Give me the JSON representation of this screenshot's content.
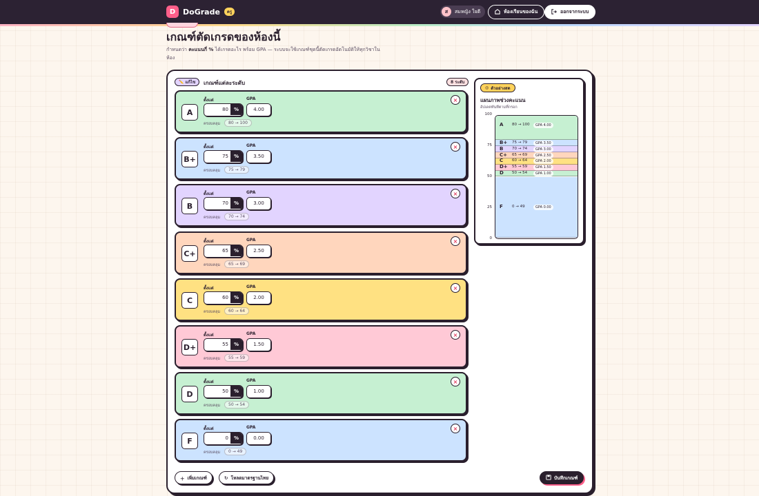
{
  "header": {
    "logo_letter": "D",
    "app_name": "DoGrade",
    "badge": "ครู",
    "user_initial": "ส",
    "user_name": "สมหญิง ใจดี",
    "classroom_btn": "ห้องเรียนของฉัน",
    "logout_btn": "ออกจากระบบ"
  },
  "page": {
    "title": "เกณฑ์ตัดเกรดของห้องนี้",
    "desc_pre": "กำหนดว่า ",
    "desc_bold": "คะแนนกี่ %",
    "desc_post": " ได้เกรดอะไร พร้อม GPA — ระบบจะใช้เกณฑ์ชุดนี้ตัดเกรดอัตโนมัติให้ทุกวิชาในห้อง"
  },
  "editor": {
    "pill": "✏️ แก้ไข",
    "title": "เกณฑ์แต่ละระดับ",
    "level_count": "8 ระดับ",
    "label_from": "ตั้งแต่",
    "label_gpa": "GPA",
    "label_range": "ครอบคลุม",
    "percent_sign": "%",
    "grades": [
      {
        "grade": "A",
        "min": "80",
        "gpa": "4.00",
        "range": "80 → 100",
        "color": "#c6f0d2"
      },
      {
        "grade": "B+",
        "min": "75",
        "gpa": "3.50",
        "range": "75 → 79",
        "color": "#cce3ff"
      },
      {
        "grade": "B",
        "min": "70",
        "gpa": "3.00",
        "range": "70 → 74",
        "color": "#e2d4ff"
      },
      {
        "grade": "C+",
        "min": "65",
        "gpa": "2.50",
        "range": "65 → 69",
        "color": "#ffd6bd"
      },
      {
        "grade": "C",
        "min": "60",
        "gpa": "2.00",
        "range": "60 → 64",
        "color": "#ffe182"
      },
      {
        "grade": "D+",
        "min": "55",
        "gpa": "1.50",
        "range": "55 → 59",
        "color": "#ffc9d6"
      },
      {
        "grade": "D",
        "min": "50",
        "gpa": "1.00",
        "range": "50 → 54",
        "color": "#c6f0d2"
      },
      {
        "grade": "F",
        "min": "0",
        "gpa": "0.00",
        "range": "0 → 49",
        "color": "#cce3ff"
      }
    ]
  },
  "actions": {
    "add": "เพิ่มเกณฑ์",
    "load_standard": "โหลดมาตรฐานไทย",
    "save": "บันทึกเกณฑ์"
  },
  "preview": {
    "pill": "ตัวอย่างสด",
    "title": "แผนภาพช่วงคะแนน",
    "subtitle": "อัปเดตทันทีตามที่กรอก",
    "ticks": [
      "100",
      "75",
      "50",
      "25",
      "0"
    ],
    "bars": [
      {
        "grade": "A",
        "from": 80,
        "to": 100,
        "range": "80 → 100",
        "gpa": "GPA 4.00"
      },
      {
        "grade": "B+",
        "from": 75,
        "to": 79,
        "range": "75 → 79",
        "gpa": "GPA 3.50"
      },
      {
        "grade": "B",
        "from": 70,
        "to": 74,
        "range": "70 → 74",
        "gpa": "GPA 3.00"
      },
      {
        "grade": "C+",
        "from": 65,
        "to": 69,
        "range": "65 → 69",
        "gpa": "GPA 2.50"
      },
      {
        "grade": "C",
        "from": 60,
        "to": 64,
        "range": "60 → 64",
        "gpa": "GPA 2.00"
      },
      {
        "grade": "D+",
        "from": 55,
        "to": 59,
        "range": "55 → 59",
        "gpa": "GPA 1.50"
      },
      {
        "grade": "D",
        "from": 50,
        "to": 54,
        "range": "50 → 54",
        "gpa": "GPA 1.00"
      },
      {
        "grade": "F",
        "from": 0,
        "to": 49,
        "range": "0 → 49",
        "gpa": "GPA 0.00"
      }
    ]
  }
}
